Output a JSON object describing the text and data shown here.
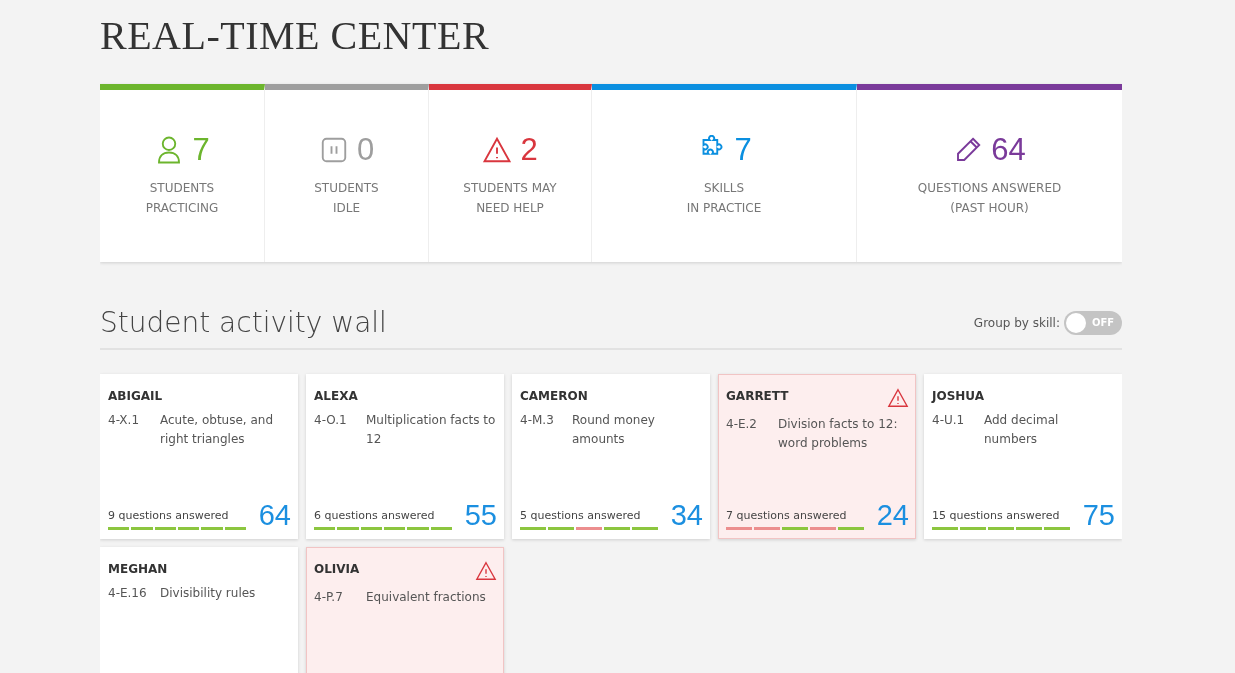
{
  "title": "REAL-TIME CENTER",
  "stats": [
    {
      "kind": "students",
      "color": "#6cb52d",
      "value": "7",
      "label": [
        "STUDENTS",
        "PRACTICING"
      ]
    },
    {
      "kind": "idle",
      "color": "#9e9e9e",
      "value": "0",
      "label": [
        "STUDENTS",
        "IDLE"
      ]
    },
    {
      "kind": "alert",
      "color": "#d9363e",
      "value": "2",
      "label": [
        "STUDENTS MAY",
        "NEED HELP"
      ]
    },
    {
      "kind": "skills",
      "color": "#0a8fe0",
      "value": "7",
      "label": [
        "SKILLS",
        "IN PRACTICE"
      ]
    },
    {
      "kind": "questions",
      "color": "#7a3a9a",
      "value": "64",
      "label": [
        "QUESTIONS ANSWERED",
        "(PAST HOUR)"
      ]
    }
  ],
  "wall": {
    "heading": "Student activity wall",
    "toggle": {
      "label": "Group by skill:",
      "on": false,
      "state_text": "OFF"
    }
  },
  "students": [
    {
      "name": "ABIGAIL",
      "needs_help": false,
      "skill_code": "4-X.1",
      "skill": "Acute, obtuse, and right triangles",
      "answered": "9 questions answered",
      "score": "64",
      "segments": [
        true,
        true,
        true,
        true,
        true,
        true
      ]
    },
    {
      "name": "ALEXA",
      "needs_help": false,
      "skill_code": "4-O.1",
      "skill": "Multiplication facts to 12",
      "answered": "6 questions answered",
      "score": "55",
      "segments": [
        true,
        true,
        true,
        true,
        true,
        true
      ]
    },
    {
      "name": "CAMERON",
      "needs_help": false,
      "skill_code": "4-M.3",
      "skill": "Round money amounts",
      "answered": "5 questions answered",
      "score": "34",
      "segments": [
        true,
        true,
        false,
        true,
        true
      ]
    },
    {
      "name": "GARRETT",
      "needs_help": true,
      "skill_code": "4-E.2",
      "skill": "Division facts to 12: word problems",
      "answered": "7 questions answered",
      "score": "24",
      "segments": [
        false,
        false,
        true,
        false,
        true
      ]
    },
    {
      "name": "JOSHUA",
      "needs_help": false,
      "skill_code": "4-U.1",
      "skill": "Add decimal numbers",
      "answered": "15 questions answered",
      "score": "75",
      "segments": [
        true,
        true,
        true,
        true,
        true
      ]
    },
    {
      "name": "MEGHAN",
      "needs_help": false,
      "skill_code": "4-E.16",
      "skill": "Divisibility rules"
    },
    {
      "name": "OLIVIA",
      "needs_help": true,
      "skill_code": "4-P.7",
      "skill": "Equivalent fractions"
    }
  ]
}
